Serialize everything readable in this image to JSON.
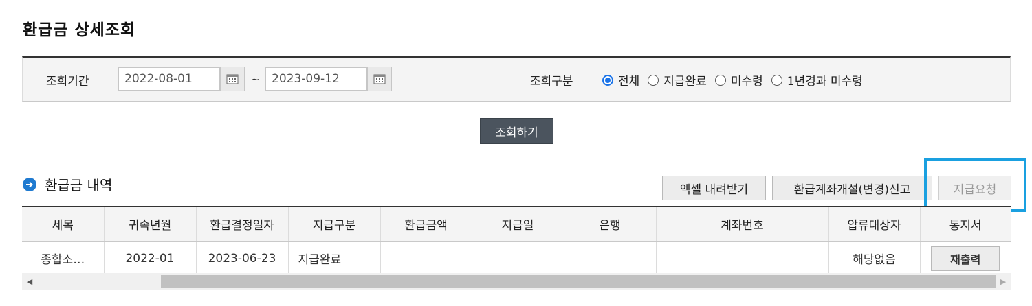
{
  "page": {
    "title": "환급금 상세조회"
  },
  "search": {
    "period_label": "조회기간",
    "start_date": "2022-08-01",
    "tilde": "~",
    "end_date": "2023-09-12",
    "type_label": "조회구분",
    "options": [
      "전체",
      "지급완료",
      "미수령",
      "1년경과 미수령"
    ],
    "selected": "전체",
    "button_label": "조회하기"
  },
  "section": {
    "title": "환급금 내역",
    "excel_button": "엑셀 내려받기",
    "account_button": "환급계좌개설(변경)신고",
    "payment_request_button": "지급요청"
  },
  "table": {
    "headers": [
      "세목",
      "귀속년월",
      "환급결정일자",
      "지급구분",
      "환급금액",
      "지급일",
      "은행",
      "계좌번호",
      "압류대상자",
      "통지서"
    ],
    "rows": [
      [
        "종합소…",
        "2022-01",
        "2023-06-23",
        "지급완료",
        "",
        "",
        "",
        "",
        "해당없음",
        "재출력"
      ]
    ]
  },
  "colors": {
    "accent_blue": "#1a73e8",
    "highlight": "#1aa0e0",
    "dark_button": "#4b545e"
  }
}
